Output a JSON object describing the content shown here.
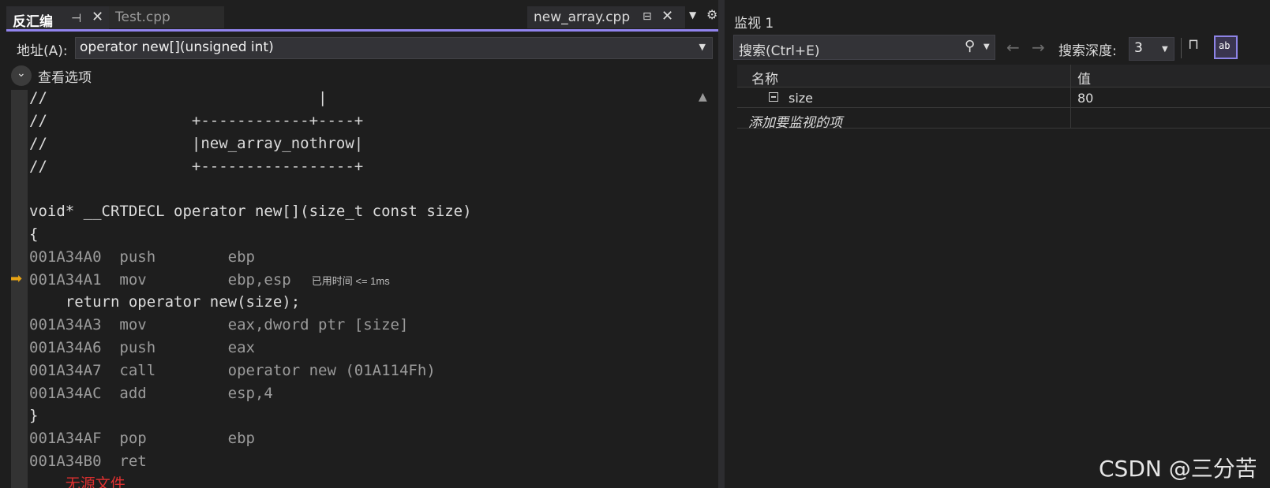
{
  "left_pane": {
    "tabs": {
      "disassembly": "反汇编",
      "test_cpp": "Test.cpp",
      "new_array_cpp": "new_array.cpp"
    },
    "address_label": "地址(A):",
    "address_value": "operator new[](unsigned int)",
    "view_options_label": "查看选项",
    "code_lines": [
      "//                              |",
      "//                +------------+----+",
      "//                |new_array_nothrow|",
      "//                +-----------------+",
      "",
      "void* __CRTDECL operator new[](size_t const size)",
      "{",
      "001A34A0  push        ebp",
      "001A34A1  mov         ebp,esp",
      "    return operator new(size);",
      "001A34A3  mov         eax,dword ptr [size]",
      "001A34A6  push        eax",
      "001A34A7  call        operator new (01A114Fh)",
      "001A34AC  add         esp,4",
      "}",
      "001A34AF  pop         ebp",
      "001A34B0  ret",
      "    无源文件"
    ],
    "elapsed_hint": "已用时间 <= 1ms"
  },
  "watch_pane": {
    "title": "监视 1",
    "search_placeholder": "搜索(Ctrl+E)",
    "depth_label": "搜索深度:",
    "depth_value": "3",
    "col_name": "名称",
    "col_value": "值",
    "rows": [
      {
        "name": "size",
        "value": "80"
      }
    ],
    "add_watch": "添加要监视的项"
  },
  "watermark": "CSDN @三分苦",
  "icons": {
    "pin": "pin-icon",
    "close": "close-icon",
    "gear": "gear-icon",
    "search": "search-icon",
    "back": "back-arrow-icon",
    "forward": "forward-arrow-icon",
    "execution_pointer": "execution-arrow-icon"
  },
  "colors": {
    "accent": "#9184ee",
    "execution_arrow": "#e8a415",
    "background": "#1e1e1e"
  }
}
